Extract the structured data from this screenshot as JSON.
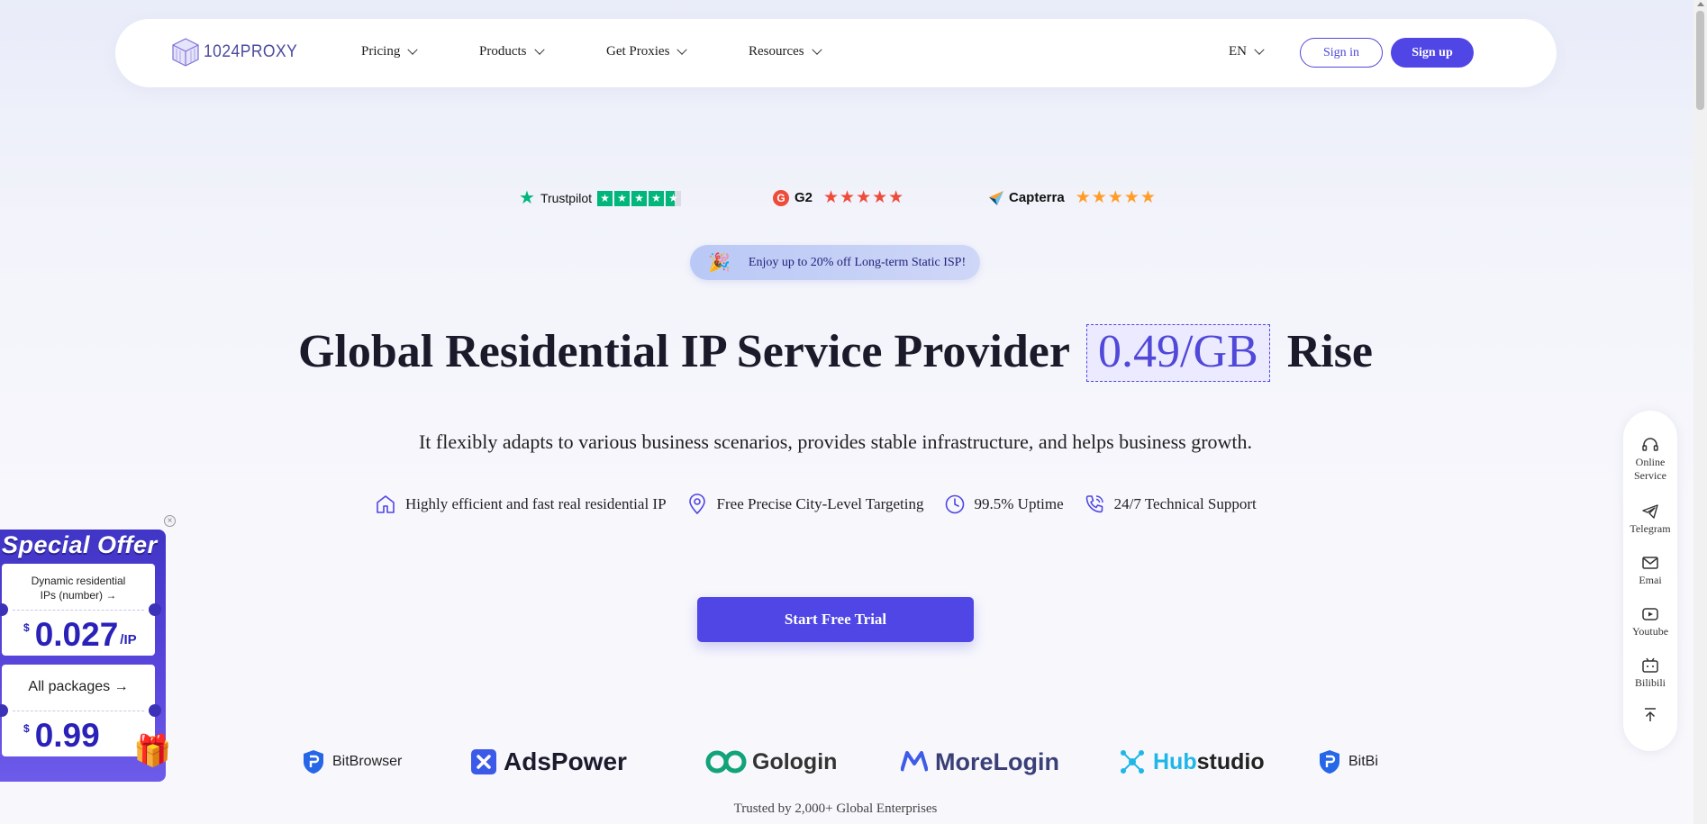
{
  "nav": {
    "logo_text": "1024PROXY",
    "items": [
      {
        "label": "Pricing"
      },
      {
        "label": "Products"
      },
      {
        "label": "Get Proxies"
      },
      {
        "label": "Resources"
      }
    ],
    "lang": "EN",
    "signin": "Sign in",
    "signup": "Sign up"
  },
  "ratings": {
    "trustpilot": {
      "label": "Trustpilot",
      "stars": "★★★★★"
    },
    "g2": {
      "logo": "G",
      "label": "G2",
      "stars": "★★★★★"
    },
    "capterra": {
      "label": "Capterra",
      "stars": "★★★★★"
    }
  },
  "promo": {
    "text": "Enjoy up to 20% off Long-term Static ISP!",
    "icon": "party-popper-icon"
  },
  "hero": {
    "title_before": "Global Residential IP Service Provider",
    "price": "0.49/GB",
    "title_after": "Rise",
    "subtitle": "It flexibly adapts to various business scenarios, provides stable infrastructure, and helps business growth."
  },
  "features": [
    {
      "icon": "home-icon",
      "label": "Highly efficient and fast real residential IP"
    },
    {
      "icon": "location-pin-icon",
      "label": "Free Precise City-Level Targeting"
    },
    {
      "icon": "clock-icon",
      "label": "99.5% Uptime"
    },
    {
      "icon": "phone-icon",
      "label": "24/7 Technical Support"
    }
  ],
  "cta": "Start Free Trial",
  "partners": [
    {
      "name": "BitBrowser"
    },
    {
      "name": "AdsPower"
    },
    {
      "name": "Gologin"
    },
    {
      "name": "MoreLogin"
    },
    {
      "name": "Hub",
      "name2": "studio"
    },
    {
      "name": "BitBi"
    }
  ],
  "trusted": "Trusted by 2,000+ Global Enterprises",
  "offer": {
    "title": "Special Offer",
    "close": "×",
    "card1": {
      "line1": "Dynamic residential",
      "line2": "IPs (number) →",
      "currency": "$",
      "price": "0.027",
      "unit": "/IP"
    },
    "card2": {
      "label": "All packages →",
      "currency": "$",
      "price": "0.99"
    }
  },
  "sidebar": [
    {
      "icon": "headset-icon",
      "line1": "Online",
      "line2": "Service"
    },
    {
      "icon": "telegram-icon",
      "line1": "Telegram",
      "line2": ""
    },
    {
      "icon": "mail-icon",
      "line1": "Emai",
      "line2": ""
    },
    {
      "icon": "youtube-icon",
      "line1": "Youtube",
      "line2": ""
    },
    {
      "icon": "bilibili-icon",
      "line1": "Bilibili",
      "line2": ""
    },
    {
      "icon": "back-to-top-icon",
      "line1": "",
      "line2": ""
    }
  ],
  "colors": {
    "accent": "#4f46e5",
    "trustpilot": "#00b67a",
    "g2": "#ef4b3a",
    "capterra": "#ff9d28"
  }
}
